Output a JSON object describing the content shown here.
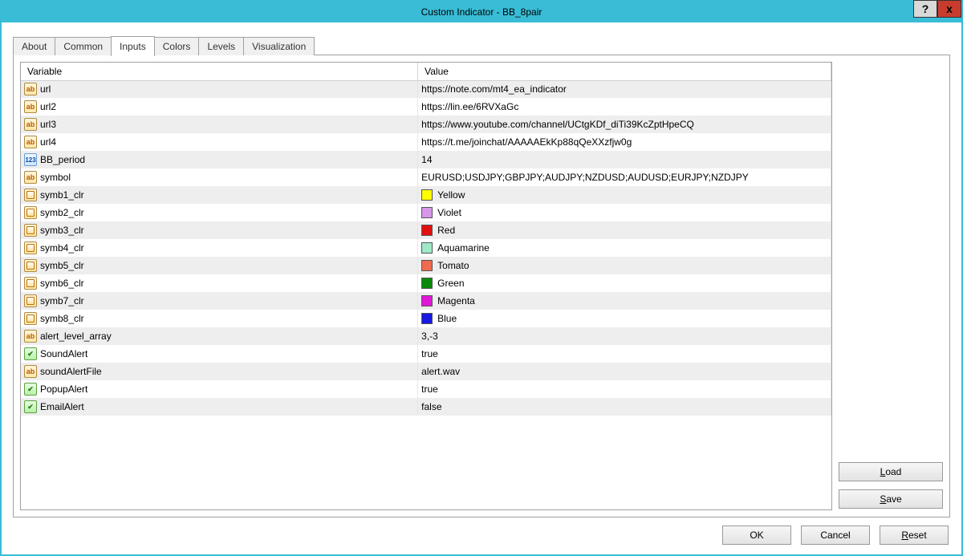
{
  "window": {
    "title": "Custom Indicator - BB_8pair",
    "help_glyph": "?",
    "close_glyph": "x"
  },
  "tabs": {
    "items": [
      "About",
      "Common",
      "Inputs",
      "Colors",
      "Levels",
      "Visualization"
    ],
    "active_index": 2
  },
  "columns": {
    "variable": "Variable",
    "value": "Value"
  },
  "rows": [
    {
      "type": "ab",
      "name": "url",
      "value": "https://note.com/mt4_ea_indicator"
    },
    {
      "type": "ab",
      "name": "url2",
      "value": "https://lin.ee/6RVXaGc"
    },
    {
      "type": "ab",
      "name": "url3",
      "value": "https://www.youtube.com/channel/UCtgKDf_diTi39KcZptHpeCQ"
    },
    {
      "type": "ab",
      "name": "url4",
      "value": "https://t.me/joinchat/AAAAAEkKp88qQeXXzfjw0g"
    },
    {
      "type": "num",
      "name": "BB_period",
      "value": "14"
    },
    {
      "type": "ab",
      "name": "symbol",
      "value": "EURUSD;USDJPY;GBPJPY;AUDJPY;NZDUSD;AUDUSD;EURJPY;NZDJPY"
    },
    {
      "type": "color",
      "name": "symb1_clr",
      "value": "Yellow",
      "swatch": "#ffff00"
    },
    {
      "type": "color",
      "name": "symb2_clr",
      "value": "Violet",
      "swatch": "#d896e8"
    },
    {
      "type": "color",
      "name": "symb3_clr",
      "value": "Red",
      "swatch": "#e01010"
    },
    {
      "type": "color",
      "name": "symb4_clr",
      "value": "Aquamarine",
      "swatch": "#9fe8c8"
    },
    {
      "type": "color",
      "name": "symb5_clr",
      "value": "Tomato",
      "swatch": "#f06a50"
    },
    {
      "type": "color",
      "name": "symb6_clr",
      "value": "Green",
      "swatch": "#0a8a0a"
    },
    {
      "type": "color",
      "name": "symb7_clr",
      "value": "Magenta",
      "swatch": "#e018d8"
    },
    {
      "type": "color",
      "name": "symb8_clr",
      "value": "Blue",
      "swatch": "#1818e0"
    },
    {
      "type": "ab",
      "name": "alert_level_array",
      "value": "3,-3"
    },
    {
      "type": "bool",
      "name": "SoundAlert",
      "value": "true"
    },
    {
      "type": "ab",
      "name": "soundAlertFile",
      "value": "alert.wav"
    },
    {
      "type": "bool",
      "name": "PopupAlert",
      "value": "true"
    },
    {
      "type": "bool",
      "name": "EmailAlert",
      "value": "false"
    }
  ],
  "side_buttons": {
    "load": "Load",
    "save": "Save"
  },
  "bottom_buttons": {
    "ok": "OK",
    "cancel": "Cancel",
    "reset": "Reset"
  }
}
